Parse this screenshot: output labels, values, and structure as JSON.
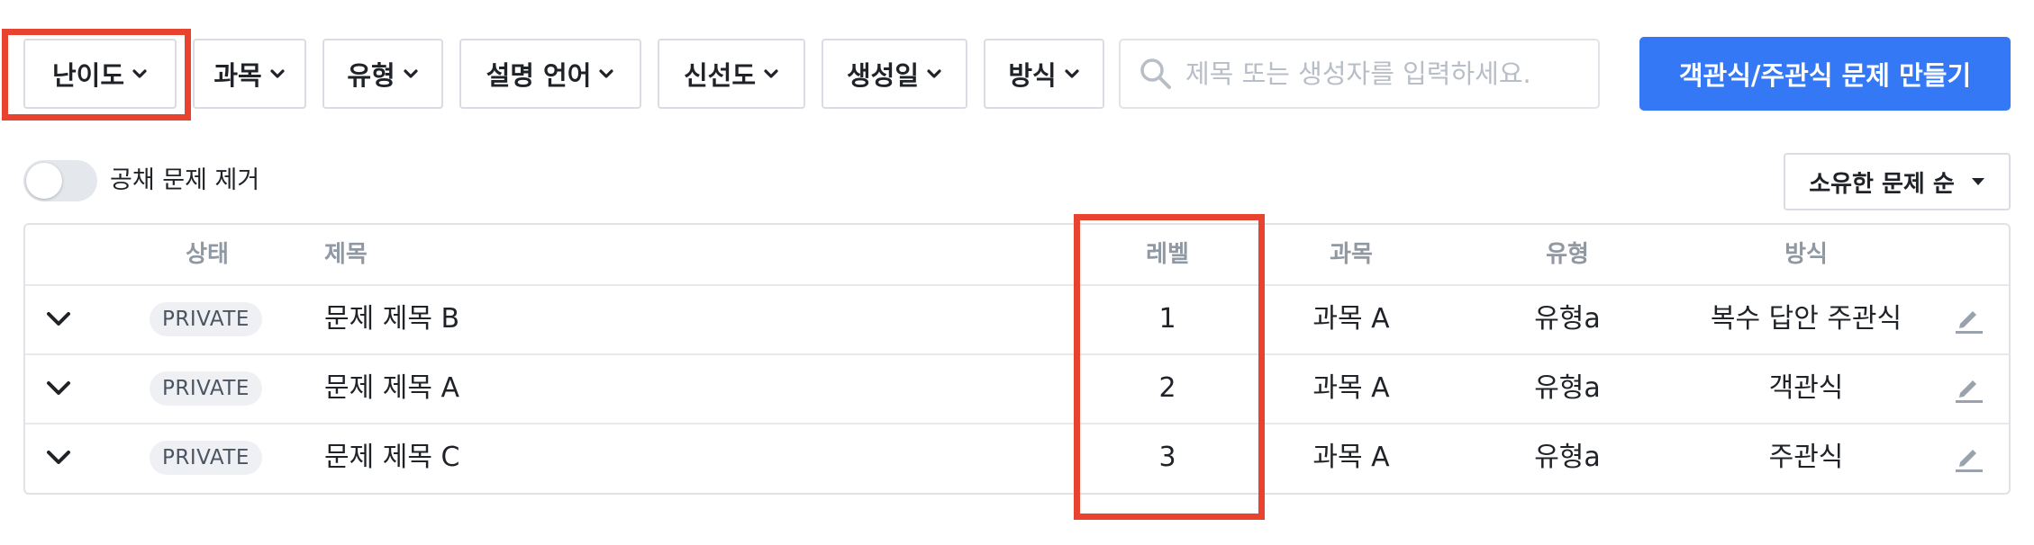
{
  "filters": [
    {
      "id": "difficulty",
      "label": "난이도"
    },
    {
      "id": "subject",
      "label": "과목"
    },
    {
      "id": "type",
      "label": "유형"
    },
    {
      "id": "language",
      "label": "설명 언어"
    },
    {
      "id": "freshness",
      "label": "신선도"
    },
    {
      "id": "created",
      "label": "생성일"
    },
    {
      "id": "method",
      "label": "방식"
    }
  ],
  "search": {
    "placeholder": "제목 또는 생성자를 입력하세요.",
    "value": ""
  },
  "create_button": "객관식/주관식 문제 만들기",
  "toggle": {
    "label": "공채 문제 제거",
    "on": false
  },
  "sort": {
    "label": "소유한 문제 순"
  },
  "table": {
    "headers": {
      "status": "상태",
      "title": "제목",
      "level": "레벨",
      "subject": "과목",
      "type": "유형",
      "method": "방식"
    },
    "rows": [
      {
        "status": "PRIVATE",
        "title": "문제 제목 B",
        "level": "1",
        "subject": "과목 A",
        "type": "유형a",
        "method": "복수 답안 주관식"
      },
      {
        "status": "PRIVATE",
        "title": "문제 제목 A",
        "level": "2",
        "subject": "과목 A",
        "type": "유형a",
        "method": "객관식"
      },
      {
        "status": "PRIVATE",
        "title": "문제 제목 C",
        "level": "3",
        "subject": "과목 A",
        "type": "유형a",
        "method": "주관식"
      }
    ]
  },
  "colors": {
    "accent": "#3478f6",
    "highlight": "#e8432e",
    "header_text": "#8f98a3"
  }
}
